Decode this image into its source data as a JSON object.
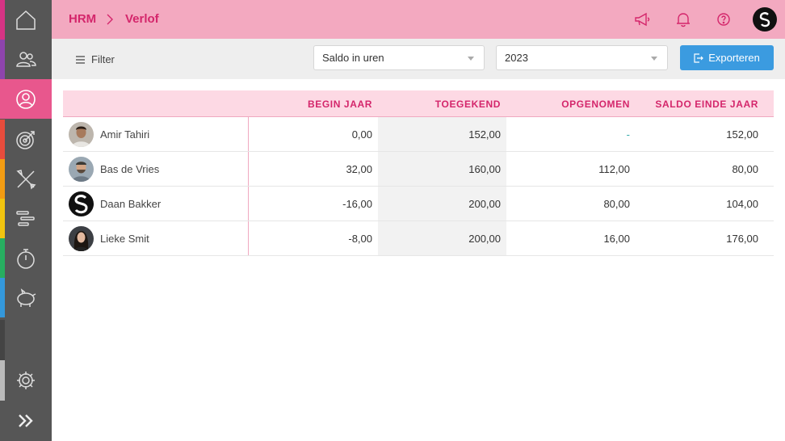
{
  "sidebar": {
    "items": [
      {
        "icon": "home-icon"
      },
      {
        "icon": "users-icon"
      },
      {
        "icon": "user-circle-icon",
        "active": true
      },
      {
        "icon": "target-icon"
      },
      {
        "icon": "tools-icon"
      },
      {
        "icon": "gantt-icon"
      },
      {
        "icon": "stopwatch-icon"
      },
      {
        "icon": "piggy-bank-icon"
      },
      {
        "icon": "gear-icon"
      },
      {
        "icon": "double-chevron-right-icon"
      }
    ],
    "stripe_colors": [
      "#d63384",
      "#8e44ad",
      "#e8578d",
      "#e74c3c",
      "#f39c12",
      "#f1c40f",
      "#27ae60",
      "#3498db",
      "#777777",
      "#bbbbbb"
    ]
  },
  "header": {
    "breadcrumb": [
      "HRM",
      "Verlof"
    ]
  },
  "toolbar": {
    "filter_label": "Filter",
    "mode_select": "Saldo in uren",
    "year_select": "2023",
    "export_label": "Exporteren"
  },
  "table": {
    "columns": [
      "",
      "BEGIN JAAR",
      "TOEGEKEND",
      "OPGENOMEN",
      "SALDO EINDE JAAR"
    ],
    "rows": [
      {
        "name": "Amir Tahiri",
        "begin": "0,00",
        "toegekend": "152,00",
        "opgenomen": "-",
        "saldo": "152,00"
      },
      {
        "name": "Bas de Vries",
        "begin": "32,00",
        "toegekend": "160,00",
        "opgenomen": "112,00",
        "saldo": "80,00"
      },
      {
        "name": "Daan Bakker",
        "begin": "-16,00",
        "toegekend": "200,00",
        "opgenomen": "80,00",
        "saldo": "104,00"
      },
      {
        "name": "Lieke Smit",
        "begin": "-8,00",
        "toegekend": "200,00",
        "opgenomen": "16,00",
        "saldo": "176,00"
      }
    ]
  },
  "colors": {
    "accent": "#d4266b",
    "header_bg": "#f3a9c0",
    "sidebar_active": "#e8578d",
    "export_button": "#3b9be0"
  }
}
